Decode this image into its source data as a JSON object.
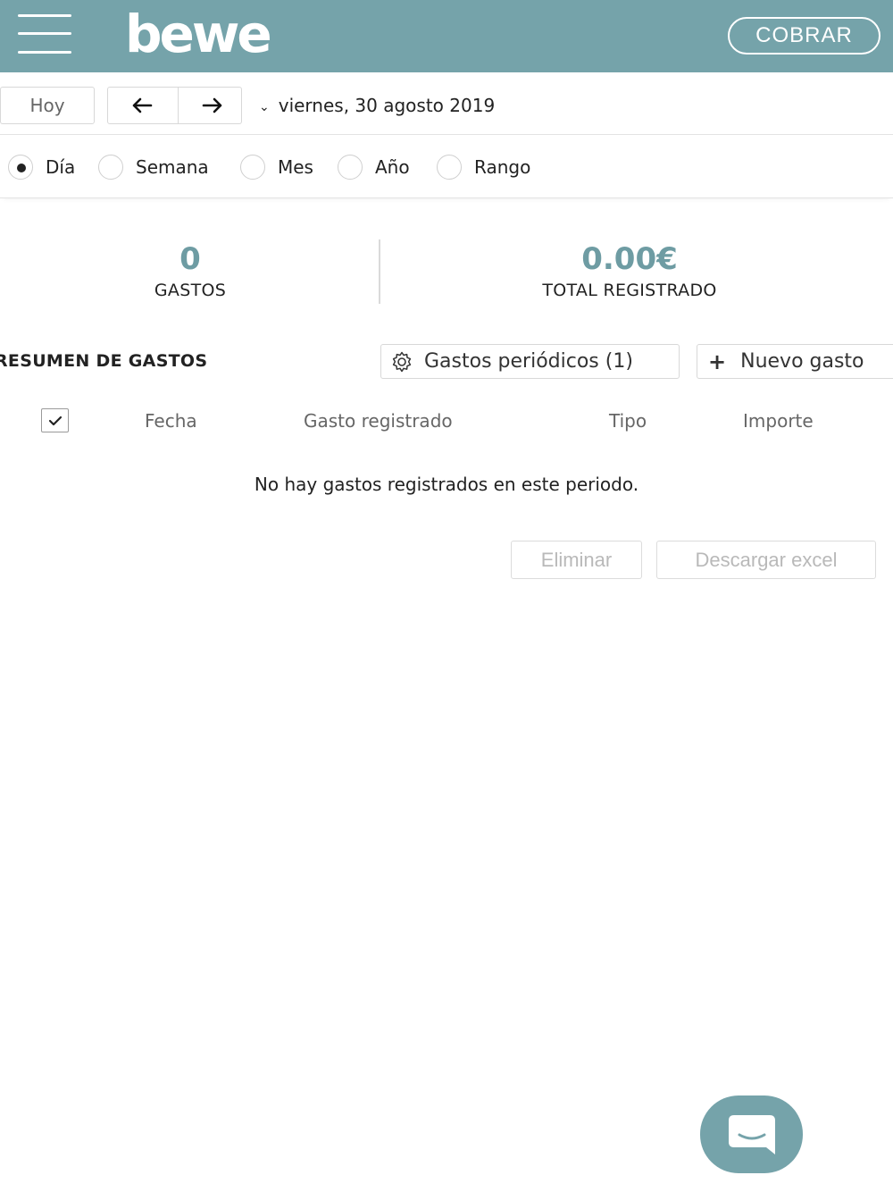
{
  "header": {
    "logo_text": "bewe",
    "cobrar_label": "COBRAR",
    "menu_icon": "hamburger-menu-icon",
    "brand_color": "#75a3aa"
  },
  "date_nav": {
    "today_label": "Hoy",
    "prev_icon": "arrow-left-icon",
    "next_icon": "arrow-right-icon",
    "current_date": "viernes, 30 agosto 2019"
  },
  "period_options": [
    {
      "label": "Día",
      "selected": true
    },
    {
      "label": "Semana",
      "selected": false
    },
    {
      "label": "Mes",
      "selected": false
    },
    {
      "label": "Año",
      "selected": false
    },
    {
      "label": "Rango",
      "selected": false
    }
  ],
  "stats": {
    "count_value": "0",
    "count_label": "GASTOS",
    "total_value": "0.00€",
    "total_label": "TOTAL REGISTRADO"
  },
  "summary": {
    "title": "RESUMEN DE GASTOS",
    "periodic_label": "Gastos periódicos (1)",
    "new_label": "Nuevo gasto"
  },
  "table": {
    "columns": [
      "Fecha",
      "Gasto registrado",
      "Tipo",
      "Importe"
    ],
    "empty_message": "No hay gastos registrados en este periodo."
  },
  "actions": {
    "delete_label": "Eliminar",
    "download_label": "Descargar excel"
  },
  "chat": {
    "icon": "chat-bubble-icon"
  }
}
